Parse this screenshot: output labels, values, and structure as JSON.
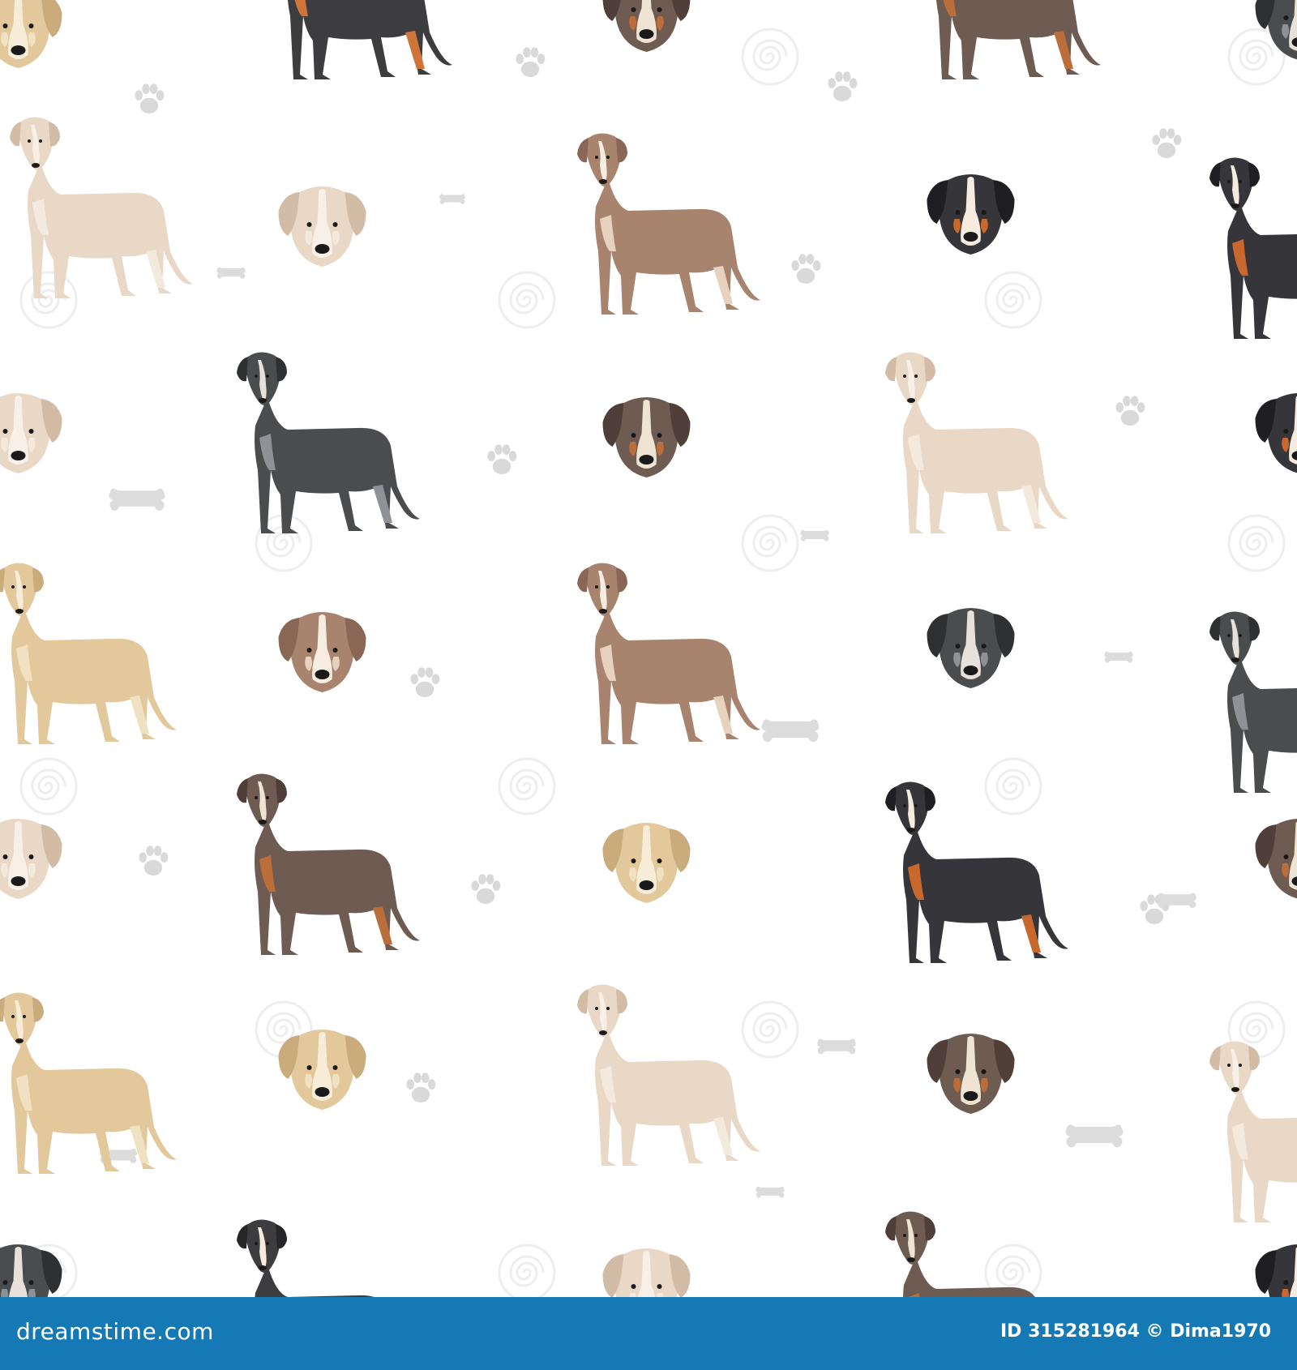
{
  "background": "#ffffff",
  "palette": {
    "bicolor_black": {
      "body": "#3d3d3f",
      "dark": "#262628",
      "light": "#d0753a",
      "blaze": "#f7ecdc"
    },
    "cream": {
      "body": "#e9d8c6",
      "dark": "#d3bca6",
      "light": "#f4e9dd",
      "blaze": "#f8f0e6"
    },
    "chocolate": {
      "body": "#6e5b52",
      "dark": "#4f3f38",
      "light": "#bb6e3a",
      "blaze": "#efe3d4"
    },
    "merle_blue": {
      "body": "#4b4c4e",
      "dark": "#2f3032",
      "light": "#8e9297",
      "blaze": "#e6e1da"
    },
    "red_brindle": {
      "body": "#a8836e",
      "dark": "#8a6654",
      "light": "#e7d2bf",
      "blaze": "#f7ece0"
    },
    "tricolor": {
      "body": "#35353a",
      "dark": "#1f1f23",
      "light": "#c8682c",
      "blaze": "#f6ebdf"
    },
    "fawn": {
      "body": "#e3c89b",
      "dark": "#c9ab7c",
      "light": "#f1e1c3",
      "blaze": "#f6ecd7"
    },
    "accents": {
      "paw_print": "#d9d9d9",
      "bone": "#dcdcdc",
      "watermark": "#eeeeee"
    }
  },
  "patterns": {
    "standing_dogs": [
      "bicolor_black",
      "chocolate",
      "cream",
      "red_brindle",
      "tricolor",
      "merle_blue",
      "cream",
      "fawn",
      "red_brindle",
      "merle_blue",
      "chocolate",
      "tricolor",
      "fawn",
      "cream"
    ],
    "head_portraits": [
      "fawn",
      "chocolate",
      "merle_blue",
      "cream",
      "tricolor",
      "cream",
      "chocolate",
      "tricolor",
      "red_brindle",
      "merle_blue",
      "cream",
      "fawn",
      "chocolate"
    ]
  },
  "icons": [
    "paw-print-icon",
    "bone-icon",
    "watermark-swirl-icon",
    "camera-icon"
  ],
  "footer": {
    "logo_text": "dreamstime.com",
    "credit_text": "ID 315281964 © Dima1970",
    "background": "#1479b4",
    "text_color": "#ffffff"
  }
}
